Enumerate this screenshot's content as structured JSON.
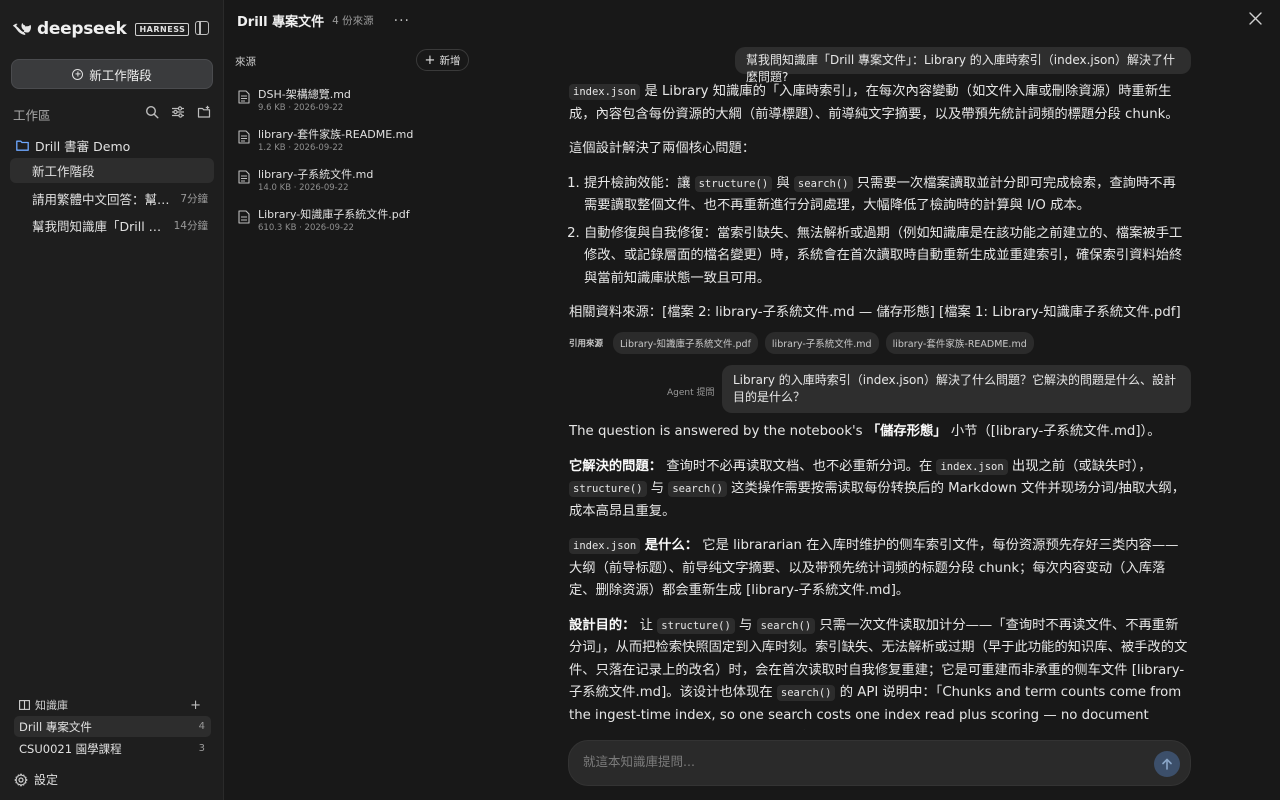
{
  "sidebar": {
    "brand": "deepseek",
    "badge": "HARNESS",
    "new_session_label": "新工作階段",
    "workspace_label": "工作區",
    "folder_name": "Drill 書審 Demo",
    "sessions": [
      {
        "title": "新工作階段",
        "time": ""
      },
      {
        "title": "請用繁體中文回答：幫我問知",
        "time": "7分鐘"
      },
      {
        "title": "幫我問知識庫「Drill 專案...",
        "time": "14分鐘"
      }
    ],
    "kb_header": "知識庫",
    "kb_add": "+",
    "kb_items": [
      {
        "name": "Drill 專案文件",
        "count": "4"
      },
      {
        "name": "CSU0021 園學課程",
        "count": "3"
      }
    ],
    "settings_label": "設定"
  },
  "header": {
    "title": "Drill 專案文件",
    "subtitle": "4 份來源",
    "more": "···"
  },
  "sources": {
    "label": "來源",
    "add_label": "新增",
    "items": [
      {
        "name": "DSH-架構總覽.md",
        "meta": "9.6 KB · 2026-09-22"
      },
      {
        "name": "library-套件家族-README.md",
        "meta": "1.2 KB · 2026-09-22"
      },
      {
        "name": "library-子系統文件.md",
        "meta": "14.0 KB · 2026-09-22"
      },
      {
        "name": "Library-知識庫子系統文件.pdf",
        "meta": "610.3 KB · 2026-09-22"
      }
    ]
  },
  "chat": {
    "q1": "幫我問知識庫「Drill 專案文件」：Library 的入庫時索引（index.json）解決了什麼問題?",
    "a1": {
      "p1_code": "index.json",
      "p1_text": " 是 Library 知識庫的「入庫時索引」，在每次內容變動（如文件入庫或刪除資源）時重新生成，內容包含每份資源的大綱（前導標題）、前導純文字摘要，以及帶預先統計詞頻的標題分段 chunk。",
      "p2": "這個設計解決了兩個核心問題：",
      "li1_a": "提升檢詢效能：讓 ",
      "li1_code1": "structure()",
      "li1_b": " 與 ",
      "li1_code2": "search()",
      "li1_c": " 只需要一次檔案讀取並計分即可完成檢索，查詢時不再需要讀取整個文件、也不再重新進行分詞處理，大幅降低了檢詢時的計算與 I/O 成本。",
      "li2": "自動修復與自我修復：當索引缺失、無法解析或過期（例如知識庫是在該功能之前建立的、檔案被手工修改、或記錄層面的檔名變更）時，系統會在首次讀取時自動重新生成並重建索引，確保索引資料始終與當前知識庫狀態一致且可用。",
      "related": "相關資料來源：[檔案 2: library-子系統文件.md — 儲存形態] [檔案 1: Library-知識庫子系統文件.pdf]"
    },
    "cite_label": "引用來源",
    "cites": [
      "Library-知識庫子系統文件.pdf",
      "library-子系統文件.md",
      "library-套件家族-README.md"
    ],
    "agent_label": "Agent 提問",
    "q2": "Library 的入庫時索引（index.json）解決了什么問題？它解決的問題是什么、設計目的是什么？",
    "a2": {
      "p1_a": "The question is answered by the notebook's ",
      "p1_b": "「儲存形態」",
      "p1_c": " 小节（[library-子系統文件.md]）。",
      "p2_label": "它解決的問題：",
      "p2_a": " 查询时不必再读取文档、也不必重新分词。在 ",
      "p2_code1": "index.json",
      "p2_b": " 出现之前（或缺失时），",
      "p2_code2": "structure()",
      "p2_c": " 与 ",
      "p2_code3": "search()",
      "p2_d": " 这类操作需要按需读取每份转换后的 Markdown 文件并现场分词/抽取大纲，成本高昂且重复。",
      "p3_code": "index.json",
      "p3_label": " 是什么：",
      "p3_text": " 它是 librararian 在入库时维护的侧车索引文件，每份资源预先存好三类内容——大纲（前导标题）、前导纯文字摘要、以及带预先统计词频的标题分段 chunk；每次内容变动（入库落定、删除资源）都会重新生成 [library-子系統文件.md]。",
      "p4_label": "設計目的：",
      "p4_a": " 让 ",
      "p4_code1": "structure()",
      "p4_b": " 与 ",
      "p4_code2": "search()",
      "p4_c": " 只需一次文件读取加计分——「查询时不再读文件、不再重新分词」，从而把检索快照固定到入库时刻。索引缺失、无法解析或过期（早于此功能的知识库、被手改的文件、只落在记录上的改名）时，会在首次读取时自我修复重建；它是可重建而非承重的侧车文件 [library-子系統文件.md]。该设计也体现在 ",
      "p4_code3": "search()",
      "p4_d": " 的 API 说明中：「Chunks and term counts come from the ingest-time index, so one search costs one index read plus scoring — no document reads or re-tokenizing」[library-子系"
    },
    "input_placeholder": "就這本知識庫提問..."
  }
}
